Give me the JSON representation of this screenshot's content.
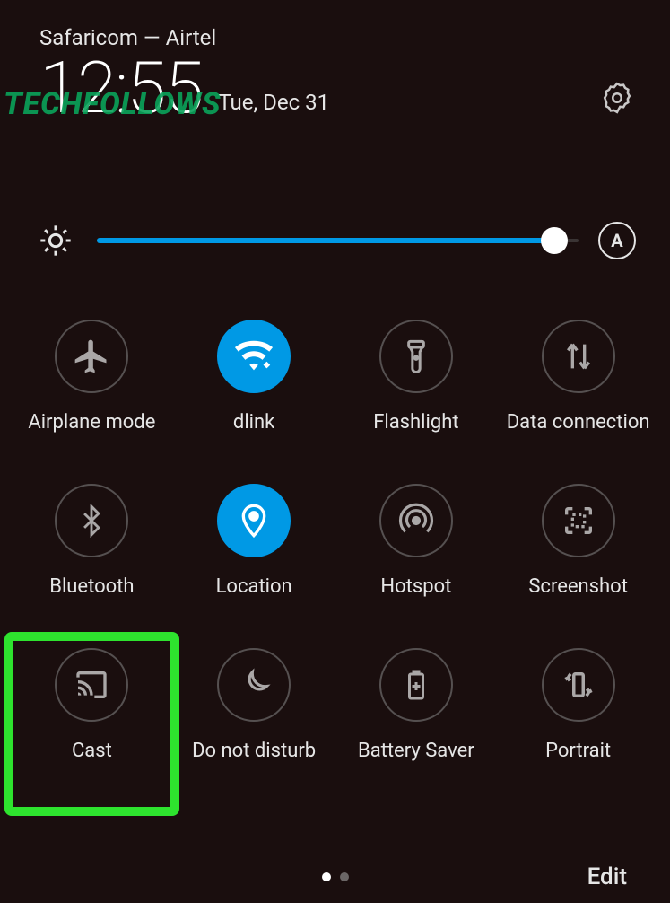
{
  "header": {
    "carrier": "Safaricom — Airtel",
    "time": "12:55",
    "date": "Tue, Dec 31"
  },
  "brightness": {
    "auto_label": "A"
  },
  "tiles": [
    {
      "label": "Airplane mode",
      "active": false
    },
    {
      "label": "dlink",
      "active": true
    },
    {
      "label": "Flashlight",
      "active": false
    },
    {
      "label": "Data connection",
      "active": false
    },
    {
      "label": "Bluetooth",
      "active": false
    },
    {
      "label": "Location",
      "active": true
    },
    {
      "label": "Hotspot",
      "active": false
    },
    {
      "label": "Screenshot",
      "active": false
    },
    {
      "label": "Cast",
      "active": false
    },
    {
      "label": "Do not disturb",
      "active": false
    },
    {
      "label": "Battery Saver",
      "active": false
    },
    {
      "label": "Portrait",
      "active": false
    }
  ],
  "footer": {
    "edit_label": "Edit"
  },
  "watermark": "TECHFOLLOWS"
}
